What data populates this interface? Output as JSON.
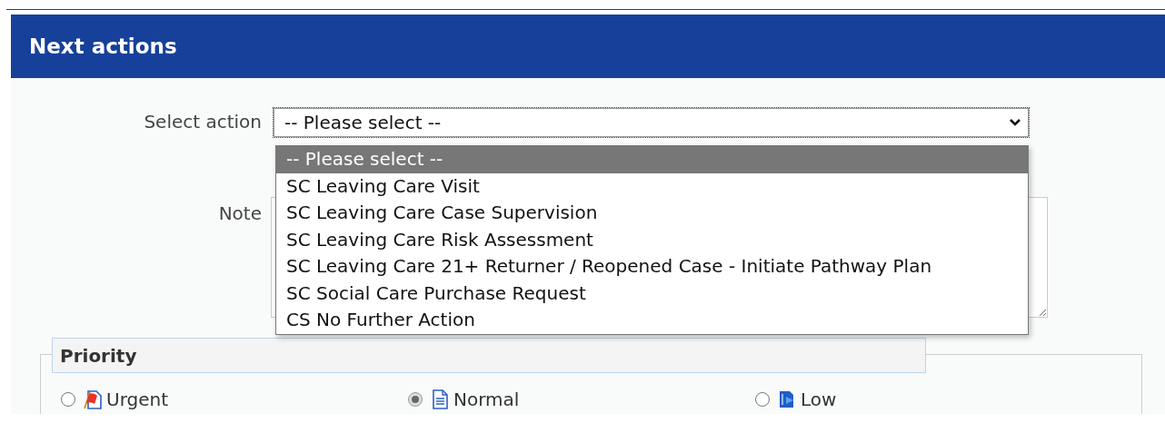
{
  "panel": {
    "title": "Next actions"
  },
  "action": {
    "label": "Select action",
    "value": "-- Please select --",
    "expanded": true,
    "options": [
      {
        "label": "-- Please select --",
        "selected": true
      },
      {
        "label": "SC Leaving Care Visit",
        "selected": false
      },
      {
        "label": "SC Leaving Care Case Supervision",
        "selected": false
      },
      {
        "label": "SC Leaving Care Risk Assessment",
        "selected": false
      },
      {
        "label": "SC Leaving Care 21+ Returner / Reopened Case - Initiate Pathway Plan",
        "selected": false
      },
      {
        "label": "SC Social Care Purchase Request",
        "selected": false
      },
      {
        "label": "CS No Further Action",
        "selected": false
      }
    ]
  },
  "note": {
    "label": "Note"
  },
  "priority": {
    "legend": "Priority",
    "options": [
      {
        "label": "Urgent",
        "kind": "urgent",
        "selected": false
      },
      {
        "label": "Normal",
        "kind": "normal",
        "selected": true
      },
      {
        "label": "Low",
        "kind": "low",
        "selected": false
      }
    ]
  }
}
